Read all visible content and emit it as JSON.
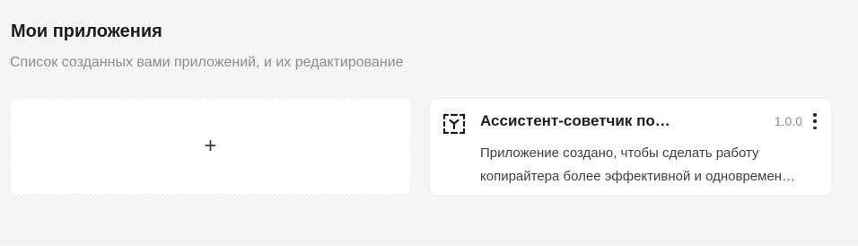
{
  "header": {
    "title": "Мои приложения",
    "subtitle": "Список созданных вами приложений, и их редактирование"
  },
  "add_card": {
    "icon": "plus-icon",
    "symbol": "+"
  },
  "apps": [
    {
      "icon": "app-frame-icon",
      "name": "Ассистент-советчик по…",
      "version": "1.0.0",
      "menu_icon": "more-vertical-icon",
      "description_lines": [
        "Приложение создано, чтобы сделать работу",
        "копирайтера более эффективной и одновремен…"
      ]
    }
  ]
}
